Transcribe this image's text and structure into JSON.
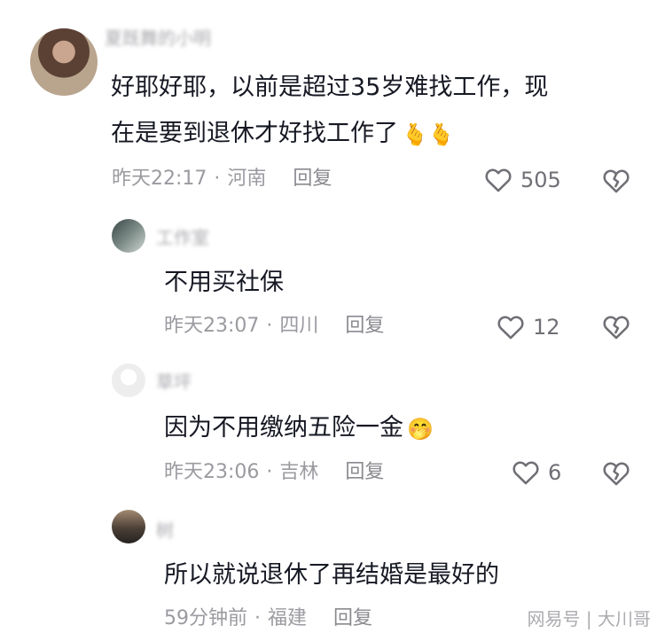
{
  "comments": [
    {
      "username": "夏既舞的小明",
      "text_line1": "好耶好耶，以前是超过35岁难找工作，现",
      "text_line2": "在是要到退休才好找工作了",
      "emojis": "🫰🫰",
      "time": "昨天22:17",
      "location": "河南",
      "reply": "回复",
      "likes": "505"
    },
    {
      "username": "工作室",
      "text": "不用买社保",
      "time": "昨天23:07",
      "location": "四川",
      "reply": "回复",
      "likes": "12"
    },
    {
      "username": "草坪",
      "text": "因为不用缴纳五险一金",
      "emoji": "🤭",
      "time": "昨天23:06",
      "location": "吉林",
      "reply": "回复",
      "likes": "6"
    },
    {
      "username": "树",
      "text": "所以就说退休了再结婚是最好的",
      "time": "59分钟前",
      "location": "福建",
      "reply": "回复"
    }
  ],
  "separator": "·",
  "watermark": "网易号 | 大川哥",
  "icons": {
    "like": "heart-outline-icon",
    "dislike": "broken-heart-icon"
  }
}
